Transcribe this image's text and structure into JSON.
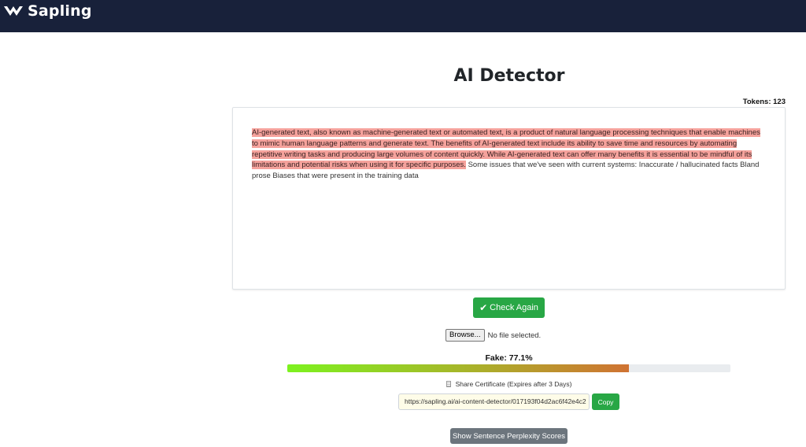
{
  "nav": {
    "brand": "Sapling",
    "logo_icon": "sapling-v-logo"
  },
  "page": {
    "title": "AI Detector"
  },
  "tokens": {
    "text": "Tokens: 123"
  },
  "editor": {
    "highlighted_text": "AI-generated text, also known as machine-generated text or automated text, is a product of natural language processing techniques that enable machines to mimic human language patterns and generate text. The benefits of AI-generated text include its ability to save time and resources by automating repetitive writing tasks and producing large volumes of content quickly. While AI-generated text can offer many benefits it is essential to be mindful of its limitations and potential risks when using it for specific purposes.",
    "plain_text": " Some issues that we've seen with current systems: Inaccurate / hallucinated facts Bland prose Biases that were present in the training data",
    "highlight_color": "#f5a29c"
  },
  "actions": {
    "check_again_label": "Check Again",
    "check_icon": "check-icon",
    "browse_label": "Browse...",
    "file_status": "No file selected."
  },
  "result": {
    "fake_label": "Fake: 77.1%",
    "fake_fraction": 0.771,
    "bar_colors": [
      "#7df21f",
      "#e84a3c"
    ]
  },
  "share": {
    "label": "Share Certificate (Expires after 3 Days)",
    "icon": "document-icon",
    "url": "https://sapling.ai/ai-content-detector/017193f04d2ac6f42e4c2",
    "copy_label": "Copy"
  },
  "perplexity": {
    "button_label": "Show Sentence Perplexity Scores"
  },
  "colors": {
    "navbar": "#18213a",
    "success": "#28a745",
    "secondary": "#6c757d"
  }
}
